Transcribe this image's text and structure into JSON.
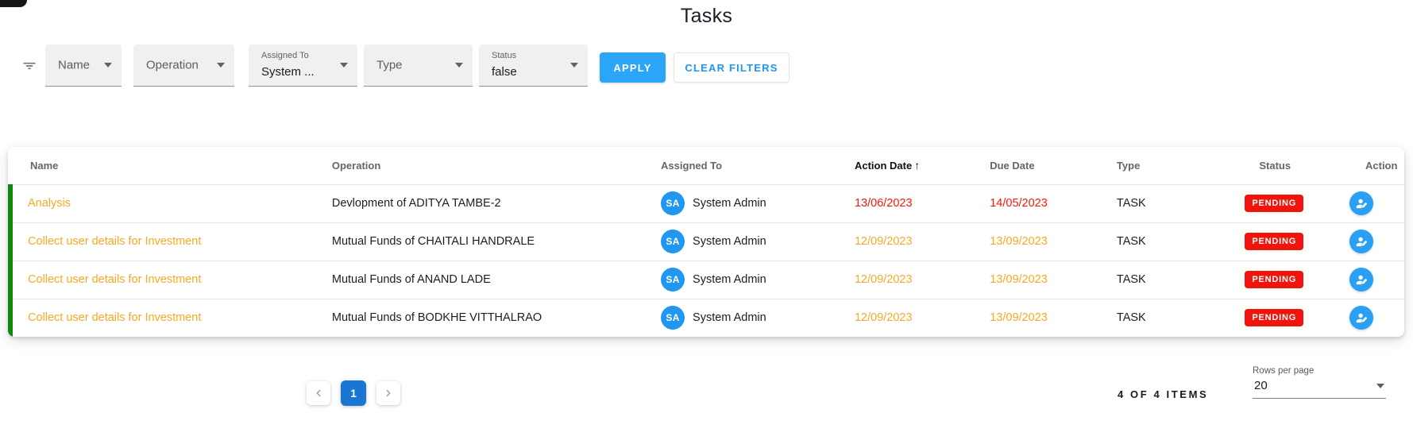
{
  "page": {
    "title": "Tasks"
  },
  "filters": {
    "fields": [
      {
        "label": "Name",
        "value": ""
      },
      {
        "label": "Operation",
        "value": ""
      },
      {
        "label": "Assigned To",
        "value": "System ..."
      },
      {
        "label": "Type",
        "value": ""
      },
      {
        "label": "Status",
        "value": "false"
      }
    ],
    "apply_label": "APPLY",
    "clear_label": "CLEAR FILTERS"
  },
  "table": {
    "columns": [
      "Name",
      "Operation",
      "Assigned To",
      "Action Date",
      "Due Date",
      "Type",
      "Status",
      "Action"
    ],
    "sort": {
      "column": "Action Date",
      "direction": "asc",
      "arrow": "↑"
    },
    "rows": [
      {
        "name": "Analysis",
        "operation": "Devlopment of ADITYA TAMBE-2",
        "assignee_initials": "SA",
        "assignee": "System Admin",
        "action_date": "13/06/2023",
        "due_date": "14/05/2023",
        "type": "TASK",
        "status": "PENDING",
        "date_state": "overdue-red"
      },
      {
        "name": "Collect user details for Investment",
        "operation": "Mutual Funds of CHAITALI HANDRALE",
        "assignee_initials": "SA",
        "assignee": "System Admin",
        "action_date": "12/09/2023",
        "due_date": "13/09/2023",
        "type": "TASK",
        "status": "PENDING",
        "date_state": "upcoming-orange"
      },
      {
        "name": "Collect user details for Investment",
        "operation": "Mutual Funds of ANAND LADE",
        "assignee_initials": "SA",
        "assignee": "System Admin",
        "action_date": "12/09/2023",
        "due_date": "13/09/2023",
        "type": "TASK",
        "status": "PENDING",
        "date_state": "upcoming-orange"
      },
      {
        "name": "Collect user details for Investment",
        "operation": "Mutual Funds of BODKHE VITTHALRAO",
        "assignee_initials": "SA",
        "assignee": "System Admin",
        "action_date": "12/09/2023",
        "due_date": "13/09/2023",
        "type": "TASK",
        "status": "PENDING",
        "date_state": "upcoming-orange"
      }
    ]
  },
  "pagination": {
    "current_page": "1",
    "items_summary": "4 OF 4 ITEMS",
    "rows_per_page_label": "Rows per page",
    "rows_per_page_value": "20"
  },
  "icons": {
    "filter": "filter-list",
    "dropdown": "chevron-down",
    "action": "assignee-edit",
    "prev": "chevron-left",
    "next": "chevron-right"
  },
  "colors": {
    "accent_blue": "#2196F3",
    "apply_blue": "#2BA5F7",
    "active_page_blue": "#1976D2",
    "row_marker_green": "#0D8A0D",
    "name_orange": "#F9A826",
    "overdue_red": "#F5190A",
    "badge_red": "#F0140C"
  }
}
